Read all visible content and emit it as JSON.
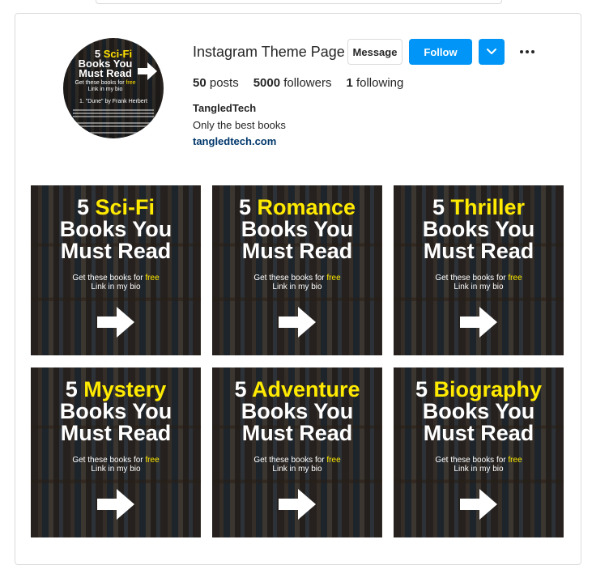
{
  "profile": {
    "username": "Instagram Theme Page",
    "message_label": "Message",
    "follow_label": "Follow",
    "stats": {
      "posts_count": "50",
      "posts_label": "posts",
      "followers_count": "5000",
      "followers_label": "followers",
      "following_count": "1",
      "following_label": "following"
    },
    "full_name": "TangledTech",
    "bio": "Only the best books",
    "website": "tangledtech.com"
  },
  "avatar": {
    "title_prefix": "5",
    "title_highlight": "Sci-Fi",
    "title_line2": "Books You",
    "title_line3": "Must Read",
    "sub_line1_prefix": "Get these books for",
    "sub_line1_highlight": "free",
    "sub_line2": "Link in my bio",
    "list_item": "1. \"Dune\" by Frank Herbert"
  },
  "posts": [
    {
      "number": "5",
      "genre": "Sci-Fi",
      "line2": "Books You",
      "line3": "Must Read",
      "sub_prefix": "Get these books for",
      "sub_highlight": "free",
      "sub_line2": "Link in my bio"
    },
    {
      "number": "5",
      "genre": "Romance",
      "line2": "Books You",
      "line3": "Must Read",
      "sub_prefix": "Get these books for",
      "sub_highlight": "free",
      "sub_line2": "Link in my bio"
    },
    {
      "number": "5",
      "genre": "Thriller",
      "line2": "Books You",
      "line3": "Must Read",
      "sub_prefix": "Get these books for",
      "sub_highlight": "free",
      "sub_line2": "Link in my bio"
    },
    {
      "number": "5",
      "genre": "Mystery",
      "line2": "Books You",
      "line3": "Must Read",
      "sub_prefix": "Get these books for",
      "sub_highlight": "free",
      "sub_line2": "Link in my bio"
    },
    {
      "number": "5",
      "genre": "Adventure",
      "line2": "Books You",
      "line3": "Must Read",
      "sub_prefix": "Get these books for",
      "sub_highlight": "free",
      "sub_line2": "Link in my bio"
    },
    {
      "number": "5",
      "genre": "Biography",
      "line2": "Books You",
      "line3": "Must Read",
      "sub_prefix": "Get these books for",
      "sub_highlight": "free",
      "sub_line2": "Link in my bio"
    }
  ],
  "colors": {
    "follow_blue": "#0095f6",
    "highlight_yellow": "#ffea00",
    "link_navy": "#00376b"
  },
  "icons": {
    "dropdown": "chevron-down-icon",
    "more": "more-options-icon",
    "arrow": "right-arrow-icon"
  }
}
